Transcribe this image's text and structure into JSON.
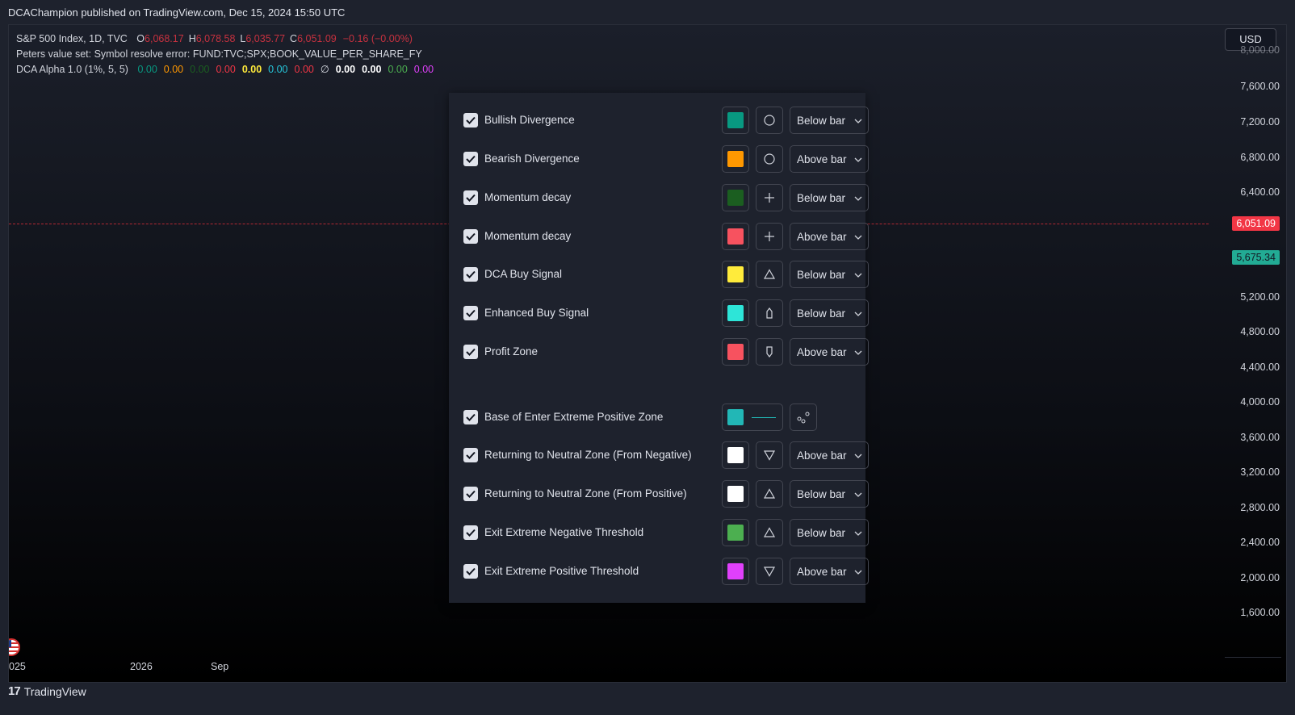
{
  "header": {
    "published": "DCAChampion published on TradingView.com, Dec 15, 2024 15:50 UTC"
  },
  "legend": {
    "symbol": "S&P 500 Index, 1D, TVC",
    "ohlc": [
      {
        "key": "O",
        "value": "6,068.17"
      },
      {
        "key": "H",
        "value": "6,078.58"
      },
      {
        "key": "L",
        "value": "6,035.77"
      },
      {
        "key": "C",
        "value": "6,051.09"
      },
      {
        "key": "",
        "value": "−0.16 (−0.00%)"
      }
    ],
    "ohlc_color": "#f23645",
    "peters": "Peters value set: Symbol resolve error: FUND:TVC;SPX;BOOK_VALUE_PER_SHARE_FY",
    "dca_label": "DCA Alpha 1.0 (1%, 5, 5)",
    "dca_values": [
      {
        "v": "0.00",
        "color": "#089981"
      },
      {
        "v": "0.00",
        "color": "#ff9800"
      },
      {
        "v": "0.00",
        "color": "#1b5e20"
      },
      {
        "v": "0.00",
        "color": "#f23645"
      },
      {
        "v": "0.00",
        "color": "#ffeb3b"
      },
      {
        "v": "0.00",
        "color": "#26c6da"
      },
      {
        "v": "0.00",
        "color": "#f23645"
      },
      {
        "v": "∅",
        "color": "#d1d4dc"
      },
      {
        "v": "0.00",
        "color": "#ffffff"
      },
      {
        "v": "0.00",
        "color": "#ffffff"
      },
      {
        "v": "0.00",
        "color": "#4caf50"
      },
      {
        "v": "0.00",
        "color": "#e040fb"
      }
    ]
  },
  "currency": "USD",
  "y_axis": {
    "labels": [
      "8,000.00",
      "7,600.00",
      "7,200.00",
      "6,800.00",
      "6,400.00",
      "5,200.00",
      "4,800.00",
      "4,400.00",
      "4,000.00",
      "3,600.00",
      "3,200.00",
      "2,800.00",
      "2,400.00",
      "2,000.00",
      "1,600.00"
    ],
    "last_price": {
      "text": "6,051.09",
      "bg": "#f23645",
      "fg": "#ffffff"
    },
    "other_price": {
      "text": "5,675.34",
      "bg": "#22ab94",
      "fg": "#131722"
    }
  },
  "x_axis": {
    "labels": [
      "025",
      "2026",
      "Sep"
    ]
  },
  "footer": {
    "brand": "TradingView",
    "logo": "17"
  },
  "panel": {
    "rows": [
      {
        "label": "Bullish Divergence",
        "color": "#089981",
        "shape": "circle",
        "location": "Below bar"
      },
      {
        "label": "Bearish Divergence",
        "color": "#ff9800",
        "shape": "circle",
        "location": "Above bar"
      },
      {
        "label": "Momentum decay",
        "color": "#1b5e20",
        "shape": "cross",
        "location": "Below bar"
      },
      {
        "label": "Momentum decay",
        "color": "#f7525f",
        "shape": "cross",
        "location": "Above bar"
      },
      {
        "label": "DCA Buy Signal",
        "color": "#ffeb3b",
        "shape": "triangle-up",
        "location": "Below bar"
      },
      {
        "label": "Enhanced Buy Signal",
        "color": "#2de5d8",
        "shape": "arrow-up-flag",
        "location": "Below bar"
      },
      {
        "label": "Profit Zone",
        "color": "#f7525f",
        "shape": "arrow-down-flag",
        "location": "Above bar"
      },
      {
        "label": "Base of Enter Extreme Positive Zone",
        "color": "#22b7b6",
        "shape": "line",
        "location": ""
      },
      {
        "label": "Returning to Neutral Zone (From Negative)",
        "color": "#ffffff",
        "shape": "triangle-down",
        "location": "Above bar"
      },
      {
        "label": "Returning to Neutral Zone (From Positive)",
        "color": "#ffffff",
        "shape": "triangle-up",
        "location": "Below bar"
      },
      {
        "label": "Exit Extreme Negative Threshold",
        "color": "#4caf50",
        "shape": "triangle-up",
        "location": "Below bar"
      },
      {
        "label": "Exit Extreme Positive Threshold",
        "color": "#e040fb",
        "shape": "triangle-down",
        "location": "Above bar"
      }
    ]
  }
}
